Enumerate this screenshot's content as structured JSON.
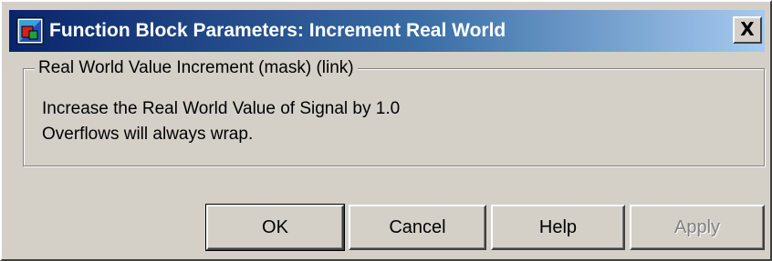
{
  "window": {
    "title": "Function Block Parameters: Increment Real World",
    "close_label": "X",
    "icon": "simulink-block-icon"
  },
  "group": {
    "legend": "Real World Value Increment (mask) (link)",
    "description_lines": [
      "Increase the Real World Value of Signal by 1.0",
      "Overflows will always wrap."
    ]
  },
  "buttons": {
    "ok": "OK",
    "cancel": "Cancel",
    "help": "Help",
    "apply": "Apply"
  },
  "state": {
    "apply_enabled": false
  },
  "colors": {
    "dialog_face": "#d4d0c8",
    "title_start": "#0a246a",
    "title_end": "#a6caf0",
    "disabled_text": "#808080"
  }
}
